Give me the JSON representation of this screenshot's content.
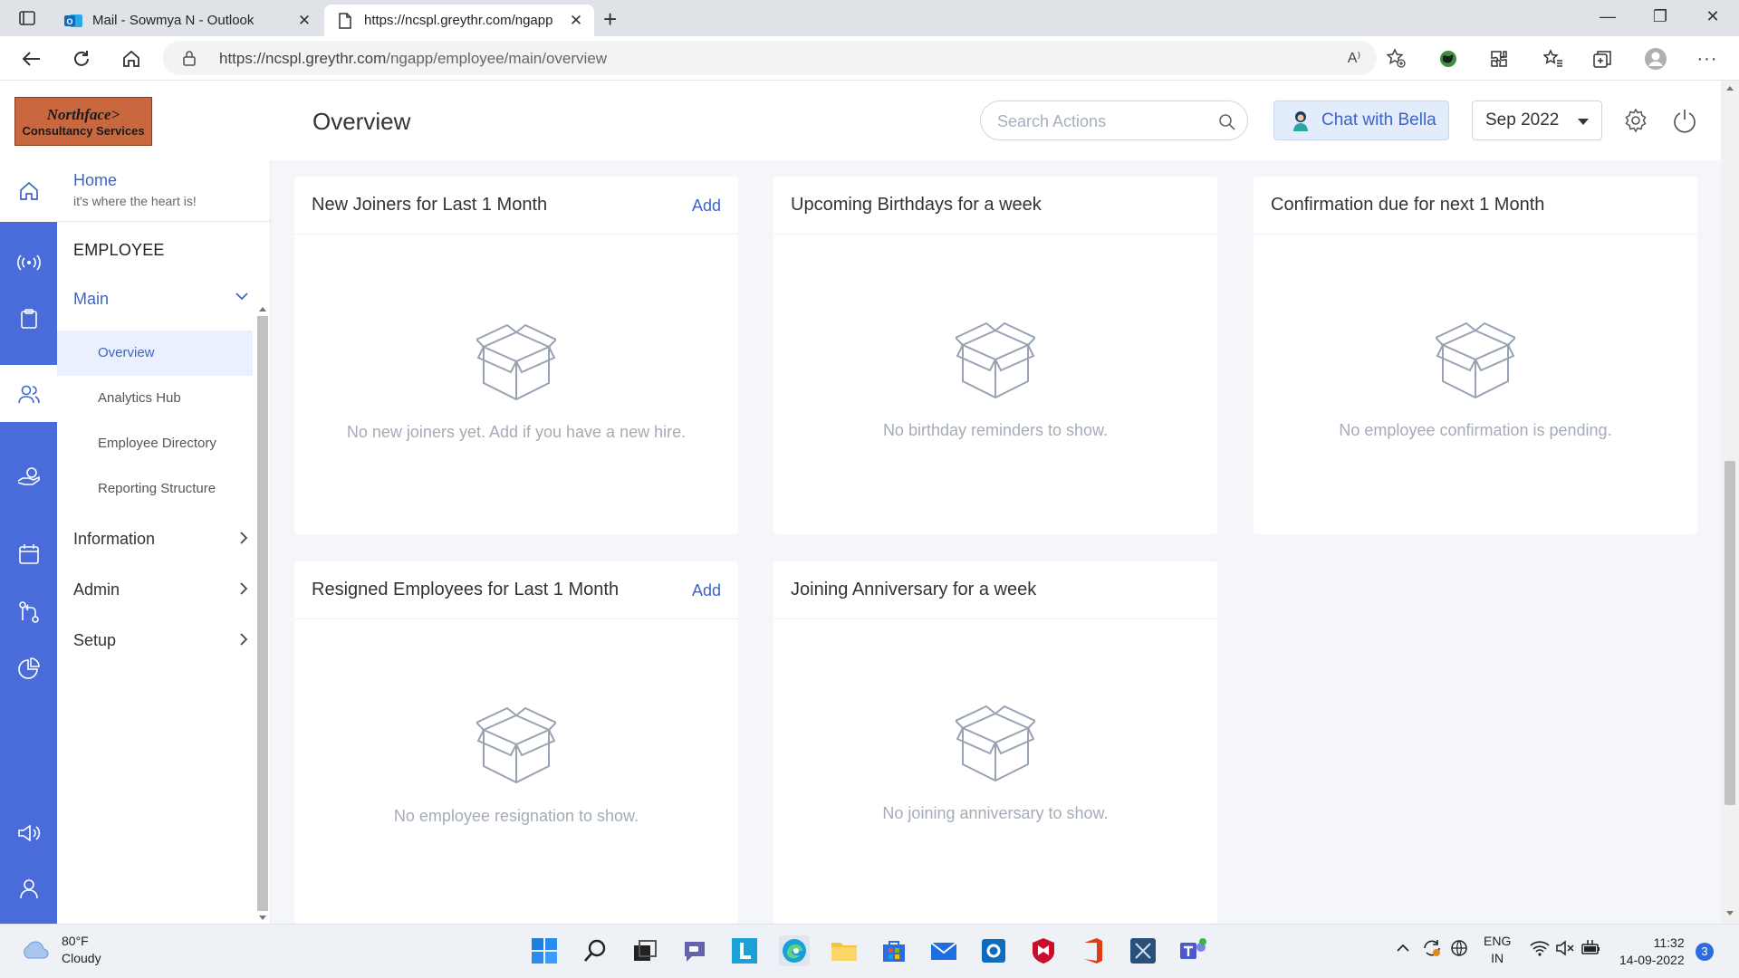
{
  "browser": {
    "tabs": [
      {
        "title": "Mail - Sowmya N - Outlook",
        "active": false
      },
      {
        "title": "https://ncspl.greythr.com/ngapp",
        "active": true
      }
    ],
    "url_host": "https://ncspl.greythr.com",
    "url_path": "/ngapp/employee/main/overview",
    "read_aloud_label": "A⁾"
  },
  "header": {
    "logo_line1": "Northface>",
    "logo_line2": "Consultancy Services",
    "page_title": "Overview",
    "search_placeholder": "Search Actions",
    "chat_label": "Chat with Bella",
    "month_selected": "Sep 2022"
  },
  "nav": {
    "home_title": "Home",
    "home_subtitle": "it's where the heart is!",
    "section": "EMPLOYEE",
    "main_label": "Main",
    "sub_items": [
      "Overview",
      "Analytics Hub",
      "Employee Directory",
      "Reporting Structure"
    ],
    "groups": [
      "Information",
      "Admin",
      "Setup"
    ]
  },
  "cards": [
    {
      "title": "New Joiners for Last 1 Month",
      "action": "Add",
      "empty": "No new joiners yet. Add if you have a new hire."
    },
    {
      "title": "Upcoming Birthdays for a week",
      "action": "",
      "empty": "No birthday reminders to show."
    },
    {
      "title": "Confirmation due for next 1 Month",
      "action": "",
      "empty": "No employee confirmation is pending."
    },
    {
      "title": "Resigned Employees for Last 1 Month",
      "action": "Add",
      "empty": "No employee resignation to show."
    },
    {
      "title": "Joining Anniversary for a week",
      "action": "",
      "empty": "No joining anniversary to show."
    }
  ],
  "taskbar": {
    "weather_temp": "80°F",
    "weather_desc": "Cloudy",
    "lang_top": "ENG",
    "lang_bottom": "IN",
    "time": "11:32",
    "date": "14-09-2022",
    "notification_count": "3"
  },
  "colors": {
    "accent": "#3d64c9",
    "rail": "#4a6cdb",
    "logo_bg": "#c9683f"
  }
}
